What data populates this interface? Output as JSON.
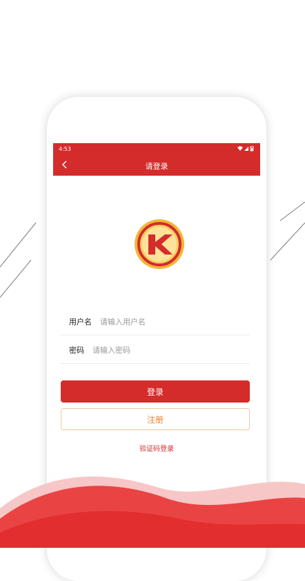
{
  "status_bar": {
    "time": "4:53",
    "icons": [
      "wifi-icon",
      "signal-icon",
      "battery-icon"
    ]
  },
  "header": {
    "title": "请登录",
    "back_icon": "chevron-left-icon"
  },
  "logo": {
    "letter": "K",
    "icon": "k-coin-logo"
  },
  "form": {
    "username_label": "用户名",
    "username_placeholder": "请输入用户名",
    "password_label": "密码",
    "password_placeholder": "请输入密码"
  },
  "actions": {
    "login_label": "登录",
    "register_label": "注册",
    "sms_login_label": "验证码登录"
  },
  "colors": {
    "accent": "#d42b2b",
    "register_text": "#e8853a",
    "register_border": "#f3c69a",
    "logo_gold": "#f0b63a"
  }
}
